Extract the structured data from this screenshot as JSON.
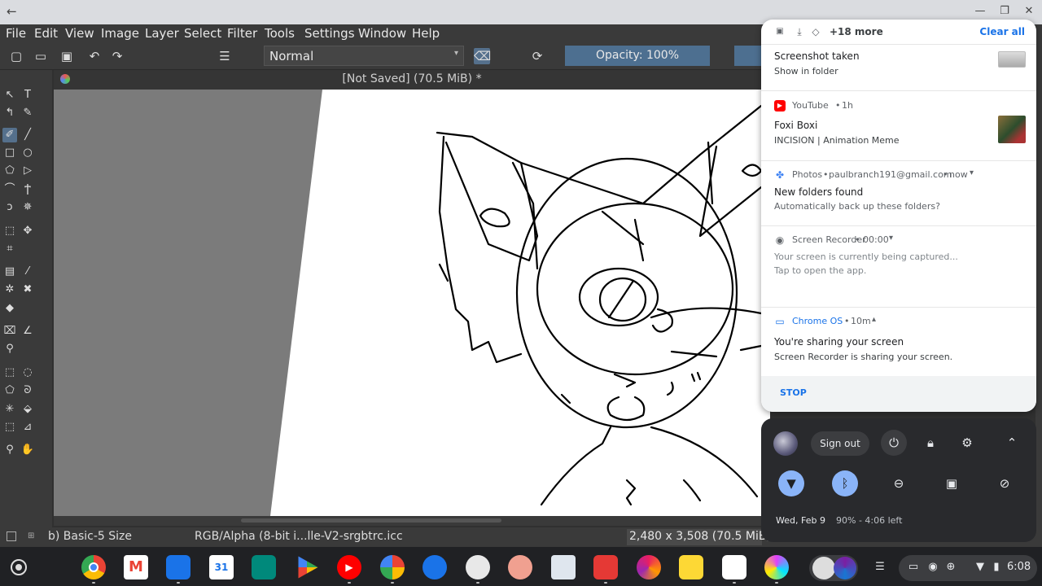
{
  "menu": [
    "File",
    "Edit",
    "View",
    "Image",
    "Layer",
    "Select",
    "Filter",
    "Tools",
    "Settings",
    "Window",
    "Help"
  ],
  "toolbar": {
    "blend_mode": "Normal",
    "opacity": "Opacity: 100%"
  },
  "document_tab": "[Not Saved]  (70.5 MiB)  *",
  "status": {
    "brush": "b) Basic-5 Size",
    "color_space": "RGB/Alpha (8-bit i...lle-V2-srgbtrc.icc",
    "size": "2,480 x 3,508 (70.5 MiB)"
  },
  "notifications": {
    "header_more": "+18 more",
    "clear_all": "Clear all",
    "items": [
      {
        "title": "Screenshot taken",
        "subtitle": "Show in folder"
      },
      {
        "app": "YouTube",
        "time": "1h",
        "title": "Foxi Boxi",
        "subtitle": "INCISION | Animation Meme"
      },
      {
        "app": "Photos",
        "account": "paulbranch191@gmail.com",
        "time": "now",
        "title": "New folders found",
        "subtitle": "Automatically back up these folders?"
      },
      {
        "app": "Screen Recorder",
        "time": "00:00",
        "line1": "Your screen is currently being captured...",
        "line2": "Tap to open the app."
      },
      {
        "app": "Chrome OS",
        "time": "10m",
        "title": "You're sharing your screen",
        "subtitle": "Screen Recorder is sharing your screen.",
        "action": "STOP"
      }
    ]
  },
  "quick_settings": {
    "sign_out": "Sign out",
    "date": "Wed, Feb 9",
    "battery": "90% - 4:06 left"
  },
  "tray": {
    "time": "6:08"
  },
  "colors": {
    "accent": "#1a73e8",
    "menu_bg": "#3a3a3a",
    "opacity_bar": "#4d6f90",
    "qs_toggle": "#8ab4f8"
  },
  "icons": [
    "back-arrow-icon",
    "minimize-icon",
    "maximize-icon",
    "close-icon",
    "download-icon",
    "drive-icon",
    "youtube-icon",
    "photos-icon",
    "screen-recorder-icon",
    "cast-icon",
    "power-icon",
    "lock-icon",
    "gear-icon",
    "chevron-up-icon",
    "wifi-icon",
    "bluetooth-icon",
    "do-not-disturb-icon",
    "screen-capture-icon",
    "privacy-icon"
  ]
}
